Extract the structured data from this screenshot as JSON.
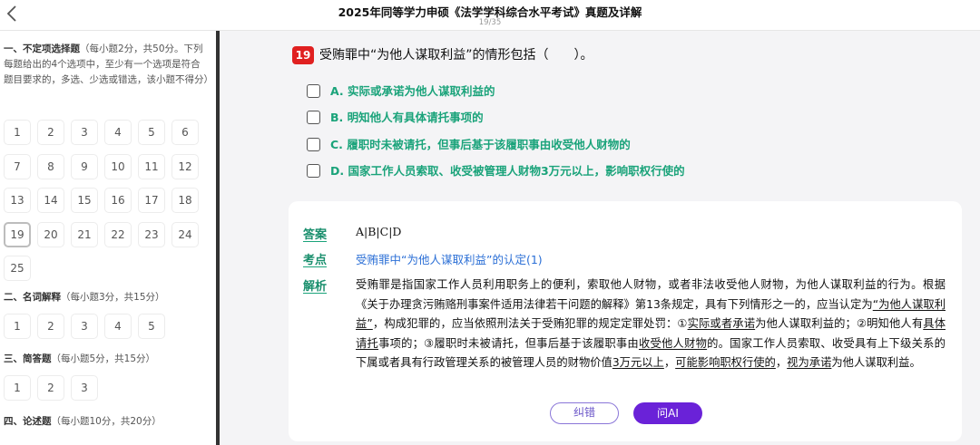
{
  "header": {
    "back_icon": "chevron-left-icon",
    "title": "2025年同等学力申硕《法学学科综合水平考试》真题及详解",
    "progress": "19/35"
  },
  "sidebar": {
    "sections": [
      {
        "title": "一、不定项选择题",
        "points": "（每小题2分，共50分。下列每题给出的4个选项中，至少有一个选项是符合题目要求的，多选、少选或错选，该小题不得分）",
        "numbers": [
          "1",
          "2",
          "3",
          "4",
          "5",
          "6",
          "7",
          "8",
          "9",
          "10",
          "11",
          "12",
          "13",
          "14",
          "15",
          "16",
          "17",
          "18",
          "19",
          "20",
          "21",
          "22",
          "23",
          "24",
          "25"
        ],
        "current": "19"
      },
      {
        "title": "二、名词解释",
        "points": "（每小题3分，共15分）",
        "numbers": [
          "1",
          "2",
          "3",
          "4",
          "5"
        ]
      },
      {
        "title": "三、简答题",
        "points": "（每小题5分，共15分）",
        "numbers": [
          "1",
          "2",
          "3"
        ]
      },
      {
        "title": "四、论述题",
        "points": "（每小题10分，共20分）",
        "numbers": []
      }
    ]
  },
  "question": {
    "number": "19",
    "text": "受贿罪中“为他人谋取利益”的情形包括（　　）。",
    "options": [
      {
        "label": "A.  实际或承诺为他人谋取利益的"
      },
      {
        "label": "B.  明知他人有具体请托事项的"
      },
      {
        "label": "C.  履职时未被请托，但事后基于该履职事由收受他人财物的"
      },
      {
        "label": "D.  国家工作人员索取、收受被管理人财物3万元以上，影响职权行使的"
      }
    ]
  },
  "explanation": {
    "answer_tag": "答案",
    "answer_value": "A|B|C|D",
    "knowledge_tag": "考点",
    "knowledge_value": "受贿罪中“为他人谋取利益”的认定(1)",
    "analysis_tag": "解析",
    "analysis": {
      "t1": "受贿罪是指国家工作人员利用职务上的便利，索取他人财物，或者非法收受他人财物，为他人谋取利益的行为。根据《关于办理贪污贿赂刑事案件适用法律若干问题的解释》第13条规定，具有下列情形之一的，应当认定为",
      "u1": "“为他人谋取利益”",
      "t2": "，构成犯罪的，应当依照刑法关于受贿犯罪的规定定罪处罚：①",
      "u2": "实际或者承诺",
      "t3": "为他人谋取利益的；②明知他人有",
      "u3": "具体请托",
      "t4": "事项的；③履职时未被请托，但事后基于该履职事由",
      "u4": "收受他人财物",
      "t5": "的。国家工作人员索取、收受具有上下级关系的下属或者具有行政管理关系的被管理人员的财物价值",
      "u5": "3万元以上",
      "t6": "，",
      "u6": "可能影响职权行使的",
      "t7": "，",
      "u7": "视为承诺",
      "t8": "为他人谋取利益。"
    },
    "correct_button": "纠错",
    "ai_button": "问AI"
  }
}
